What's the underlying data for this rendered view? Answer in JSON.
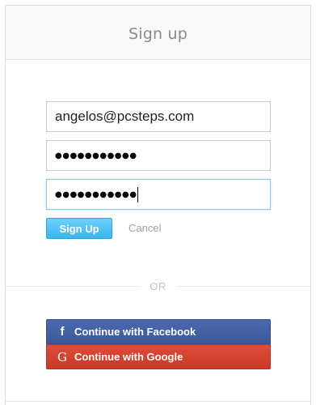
{
  "header": {
    "title": "Sign up"
  },
  "form": {
    "email_value": "angelos@pcsteps.com",
    "password_value": "●●●●●●●●●●●",
    "confirm_password_value": "●●●●●●●●●●●",
    "signup_label": "Sign Up",
    "cancel_label": "Cancel"
  },
  "divider": {
    "or_label": "OR"
  },
  "social": {
    "facebook": {
      "icon": "facebook-icon",
      "icon_glyph": "f",
      "label": "Continue with Facebook"
    },
    "google": {
      "icon": "google-icon",
      "icon_glyph": "G",
      "label": "Continue with Google"
    }
  },
  "colors": {
    "signup": "#3ab5ef",
    "facebook": "#3c5898",
    "google": "#c93a28",
    "focus_border": "#8fcdeb"
  }
}
